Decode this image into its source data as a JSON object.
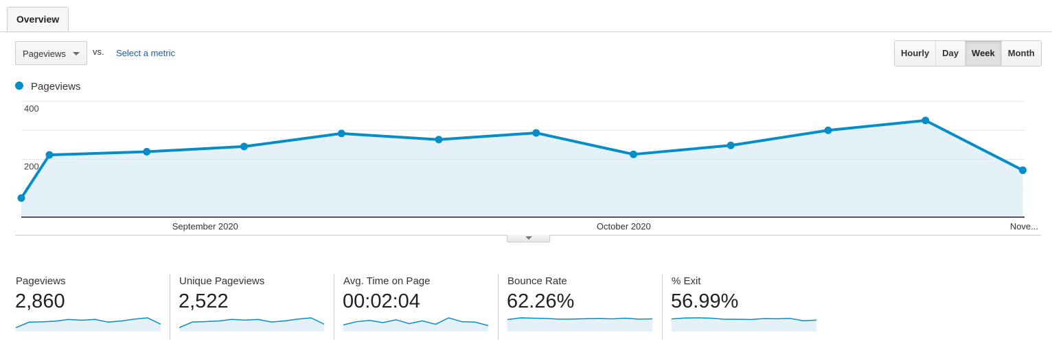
{
  "tabs": [
    {
      "label": "Overview"
    }
  ],
  "controls": {
    "primary_metric": "Pageviews",
    "vs_label": "vs.",
    "compare_link": "Select a metric",
    "granularity": [
      {
        "label": "Hourly",
        "active": false
      },
      {
        "label": "Day",
        "active": false
      },
      {
        "label": "Week",
        "active": true
      },
      {
        "label": "Month",
        "active": false
      }
    ]
  },
  "colors": {
    "series": "#058dc7",
    "fill": "#e4f1f8",
    "grid": "#eeeeee"
  },
  "chart_data": {
    "type": "area",
    "title": "",
    "legend": [
      {
        "name": "Pageviews",
        "color": "#058dc7"
      }
    ],
    "legend_position": "top-left",
    "xlabel": "",
    "ylabel": "",
    "ylim": [
      0,
      400
    ],
    "yticks_labeled": [
      200,
      400
    ],
    "grid": true,
    "x_tick_labels": [
      {
        "label": "September 2020",
        "at_index": 2.6
      },
      {
        "label": "October 2020",
        "at_index": 6.9
      },
      {
        "label": "Nove...",
        "at_index": 11
      }
    ],
    "series": [
      {
        "name": "Pageviews",
        "values": [
          66,
          215,
          226,
          244,
          289,
          268,
          291,
          217,
          248,
          300,
          334,
          162
        ],
        "first_x_offset": 0.29
      }
    ]
  },
  "scorecards": [
    {
      "label": "Pageviews",
      "value": "2,860",
      "sparkline": [
        66,
        215,
        226,
        244,
        289,
        268,
        291,
        217,
        248,
        300,
        334,
        162
      ]
    },
    {
      "label": "Unique Pageviews",
      "value": "2,522",
      "sparkline": [
        60,
        195,
        205,
        220,
        258,
        240,
        256,
        196,
        222,
        266,
        296,
        144
      ]
    },
    {
      "label": "Avg. Time on Page",
      "value": "00:02:04",
      "sparkline": [
        40,
        65,
        75,
        58,
        80,
        50,
        72,
        45,
        95,
        65,
        62,
        35
      ]
    },
    {
      "label": "Bounce Rate",
      "value": "62.26%",
      "sparkline": [
        60,
        70,
        68,
        66,
        62,
        63,
        65,
        66,
        64,
        68,
        62,
        64
      ]
    },
    {
      "label": "% Exit",
      "value": "56.99%",
      "sparkline": [
        60,
        65,
        66,
        64,
        58,
        58,
        57,
        62,
        61,
        63,
        50,
        54
      ]
    }
  ]
}
